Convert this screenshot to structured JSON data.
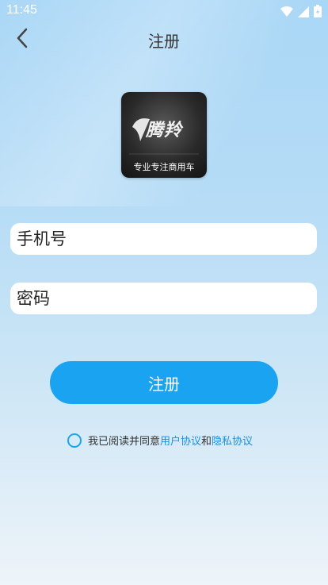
{
  "status_bar": {
    "time": "11:45",
    "icons": [
      "wifi-icon",
      "signal-icon",
      "battery-icon"
    ]
  },
  "header": {
    "title": "注册",
    "back_icon": "chevron-left-icon"
  },
  "logo": {
    "brand": "腾羚",
    "slogan": "专业专注商用车"
  },
  "form": {
    "phone": {
      "placeholder": "手机号",
      "value": ""
    },
    "password": {
      "placeholder": "密码",
      "value": ""
    },
    "register_label": "注册"
  },
  "agreement": {
    "checked": false,
    "prefix": "我已阅读并同意",
    "user_agreement": "用户协议",
    "and": "和",
    "privacy_agreement": "隐私协议"
  },
  "colors": {
    "accent": "#1aa3f0",
    "link": "#1a8fe0"
  }
}
